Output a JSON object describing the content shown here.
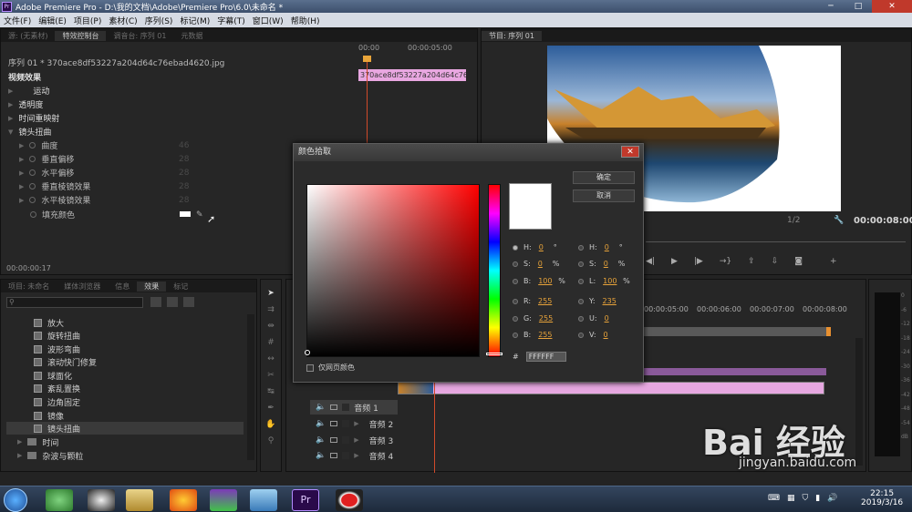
{
  "titlebar": {
    "title": "Adobe Premiere Pro - D:\\我的文档\\Adobe\\Premiere Pro\\6.0\\未命名 *",
    "logo": "Pr"
  },
  "menu": [
    "文件(F)",
    "编辑(E)",
    "项目(P)",
    "素材(C)",
    "序列(S)",
    "标记(M)",
    "字幕(T)",
    "窗口(W)",
    "帮助(H)"
  ],
  "source_tabs": [
    "源: (无素材)",
    "特效控制台",
    "调音台: 序列 01",
    "元数据"
  ],
  "effect_controls": {
    "clip": "序列 01 * 370ace8df53227a204d64c76ebad4620.jpg",
    "clip_bar": "370ace8df53227a204d64c76ebad",
    "time_a": "00:00",
    "time_b": "00:00:05:00",
    "section": "视频效果",
    "effects": [
      "运动",
      "透明度",
      "时间重映射",
      "镜头扭曲"
    ],
    "params": [
      {
        "name": "曲度",
        "value": "46"
      },
      {
        "name": "垂直偏移",
        "value": "28"
      },
      {
        "name": "水平偏移",
        "value": "28"
      },
      {
        "name": "垂直棱镜效果",
        "value": "28"
      },
      {
        "name": "水平棱镜效果",
        "value": "28"
      },
      {
        "name": "填充颜色",
        "value": ""
      }
    ],
    "timecode": "00:00:00:17"
  },
  "program": {
    "tab": "节目: 序列 01",
    "fraction": "1/2",
    "timecode": "00:00:08:00"
  },
  "project_tabs": [
    "项目: 未命名",
    "媒体浏览器",
    "信息",
    "效果",
    "标记"
  ],
  "effects_list": [
    "放大",
    "旋转扭曲",
    "波形弯曲",
    "滚动快门修复",
    "球面化",
    "紊乱置换",
    "边角固定",
    "镜像",
    "镜头扭曲"
  ],
  "effects_folders": [
    "时间",
    "杂波与颗粒"
  ],
  "timeline": {
    "ruler": [
      "00:00:05:00",
      "00:00:06:00",
      "00:00:07:00",
      "00:00:08:00"
    ],
    "audio_tracks": [
      "音频 1",
      "音频 2",
      "音频 3",
      "音频 4"
    ]
  },
  "meter": {
    "labels": [
      "0",
      "-6",
      "-12",
      "-18",
      "-24",
      "-30",
      "-36",
      "-42",
      "-48",
      "-54",
      "dB"
    ]
  },
  "color_picker": {
    "title": "颜色拾取",
    "ok": "确定",
    "cancel": "取消",
    "web_only": "仅网页颜色",
    "hex_label": "#",
    "hex": "FFFFFF",
    "hsb": [
      {
        "k": "H:",
        "v": "0",
        "u": "°"
      },
      {
        "k": "S:",
        "v": "0",
        "u": "%"
      },
      {
        "k": "B:",
        "v": "100",
        "u": "%"
      }
    ],
    "hsl": [
      {
        "k": "H:",
        "v": "0",
        "u": "°"
      },
      {
        "k": "S:",
        "v": "0",
        "u": "%"
      },
      {
        "k": "L:",
        "v": "100",
        "u": "%"
      }
    ],
    "rgb": [
      {
        "k": "R:",
        "v": "255"
      },
      {
        "k": "G:",
        "v": "255"
      },
      {
        "k": "B:",
        "v": "255"
      }
    ],
    "yuv": [
      {
        "k": "Y:",
        "v": "235"
      },
      {
        "k": "U:",
        "v": "0"
      },
      {
        "k": "V:",
        "v": "0"
      }
    ]
  },
  "taskbar": {
    "time": "22:15",
    "date": "2019/3/16"
  },
  "watermark": {
    "logo": "Bai 经验",
    "url": "jingyan.baidu.com"
  }
}
